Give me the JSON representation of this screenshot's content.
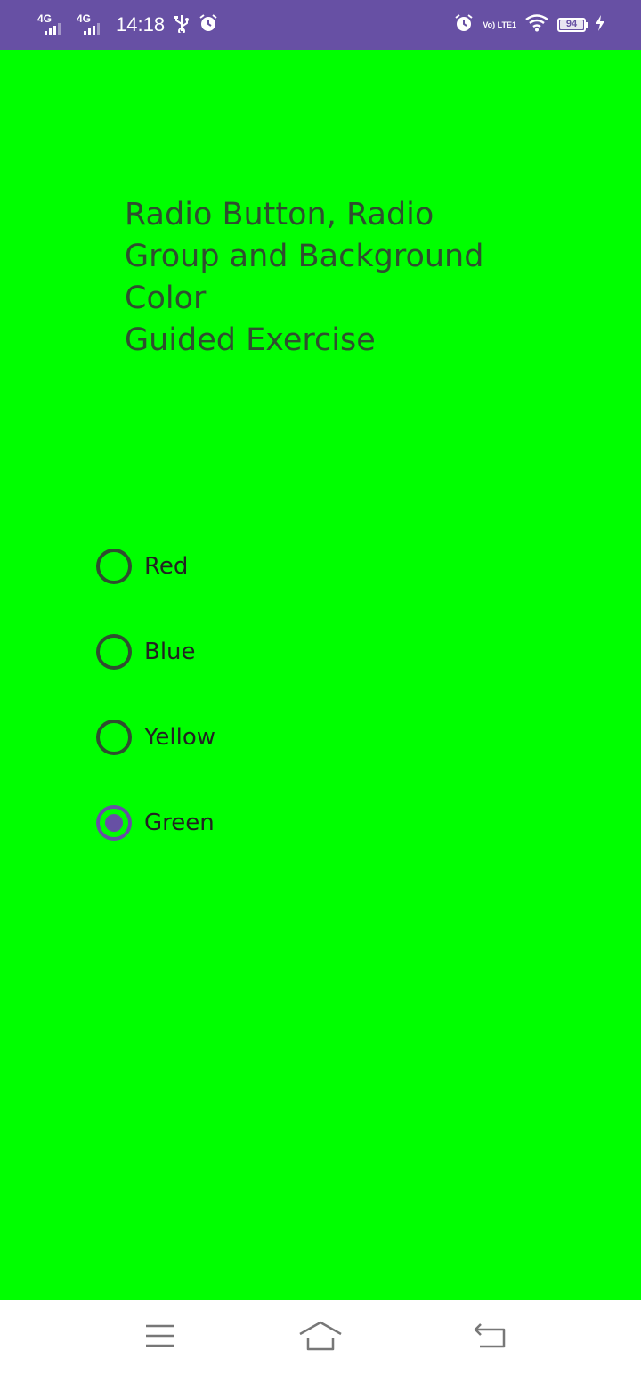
{
  "status_bar": {
    "network1": "4G",
    "network2": "4G",
    "time": "14:18",
    "volte": "Vo) LTE1",
    "battery": "94",
    "icons": [
      "signal-icon",
      "usb-icon",
      "alarm-icon",
      "wifi-icon",
      "battery-icon",
      "charging-icon"
    ]
  },
  "main": {
    "title": "Radio Button, Radio\nGroup and Background\nColor\nGuided Exercise",
    "background_color": "#00FF00",
    "radio_options": [
      {
        "label": "Red",
        "checked": false
      },
      {
        "label": "Blue",
        "checked": false
      },
      {
        "label": "Yellow",
        "checked": false
      },
      {
        "label": "Green",
        "checked": true
      }
    ]
  },
  "nav_bar": {
    "icons": [
      "menu-icon",
      "home-icon",
      "back-icon"
    ]
  },
  "colors": {
    "status_bar": "#6750A4",
    "accent": "#6750A4",
    "text": "#2F4F2F"
  }
}
